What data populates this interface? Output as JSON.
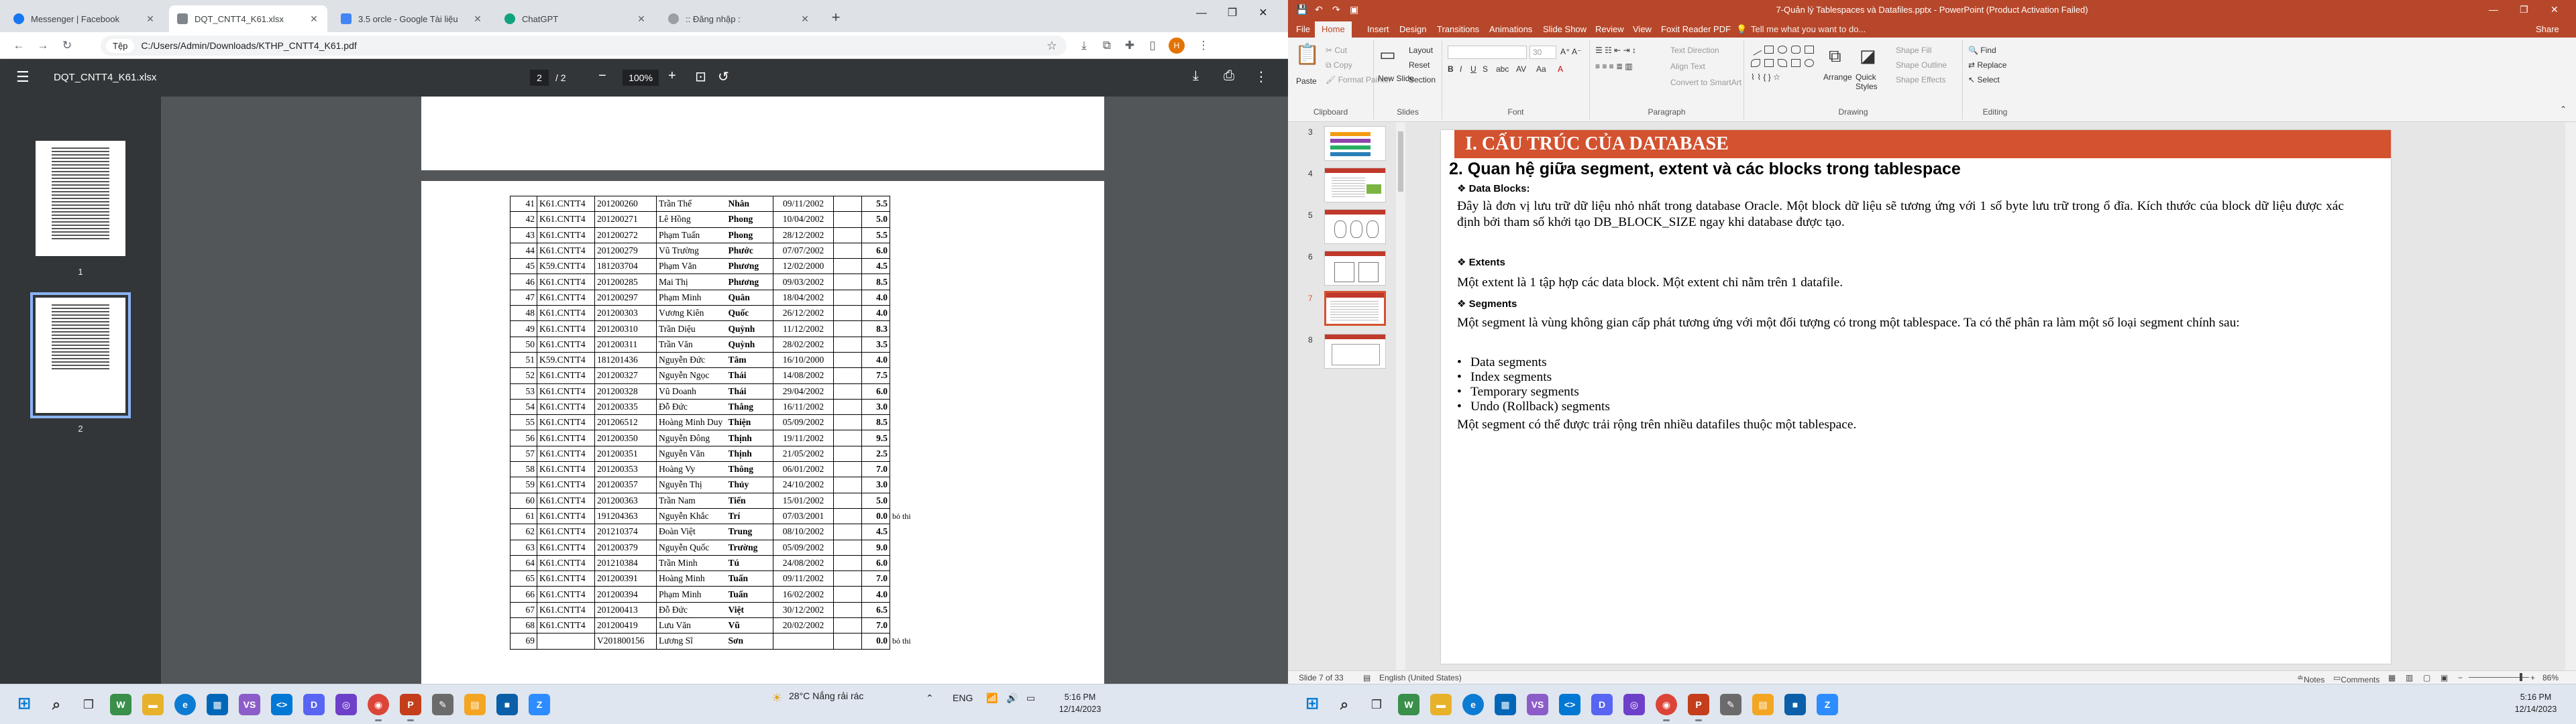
{
  "browser": {
    "tabs": [
      {
        "label": "Messenger | Facebook",
        "color": "#1877f2"
      },
      {
        "label": "DQT_CNTT4_K61.xlsx",
        "color": "#80868b"
      },
      {
        "label": "3.5 orcle - Google Tài liệu",
        "color": "#4285f4"
      },
      {
        "label": "ChatGPT",
        "color": "#10a37f"
      },
      {
        "label": ":: Đăng nhập :",
        "color": "#9aa0a6"
      }
    ],
    "omnibox_chip": "Tệp",
    "url": "C:/Users/Admin/Downloads/KTHP_CNTT4_K61.pdf",
    "profile_letter": "H"
  },
  "pdf": {
    "title": "DQT_CNTT4_K61.xlsx",
    "page_current": "2",
    "page_total": "/ 2",
    "zoom": "100%",
    "thumbnail_labels": [
      "1",
      "2"
    ],
    "rows": [
      [
        "41",
        "K61.CNTT4",
        "201200260",
        "Trần Thế",
        "Nhân",
        "09/11/2002",
        "",
        "5.5",
        ""
      ],
      [
        "42",
        "K61.CNTT4",
        "201200271",
        "Lê Hồng",
        "Phong",
        "10/04/2002",
        "",
        "5.0",
        ""
      ],
      [
        "43",
        "K61.CNTT4",
        "201200272",
        "Phạm Tuấn",
        "Phong",
        "28/12/2002",
        "",
        "5.5",
        ""
      ],
      [
        "44",
        "K61.CNTT4",
        "201200279",
        "Vũ Trường",
        "Phước",
        "07/07/2002",
        "",
        "6.0",
        ""
      ],
      [
        "45",
        "K59.CNTT4",
        "181203704",
        "Phạm Văn",
        "Phương",
        "12/02/2000",
        "",
        "4.5",
        ""
      ],
      [
        "46",
        "K61.CNTT4",
        "201200285",
        "Mai Thị",
        "Phương",
        "09/03/2002",
        "",
        "8.5",
        ""
      ],
      [
        "47",
        "K61.CNTT4",
        "201200297",
        "Phạm Minh",
        "Quân",
        "18/04/2002",
        "",
        "4.0",
        ""
      ],
      [
        "48",
        "K61.CNTT4",
        "201200303",
        "Vương Kiên",
        "Quốc",
        "26/12/2002",
        "",
        "4.0",
        ""
      ],
      [
        "49",
        "K61.CNTT4",
        "201200310",
        "Trần Diệu",
        "Quỳnh",
        "11/12/2002",
        "",
        "8.3",
        ""
      ],
      [
        "50",
        "K61.CNTT4",
        "201200311",
        "Trần Văn",
        "Quỳnh",
        "28/02/2002",
        "",
        "3.5",
        ""
      ],
      [
        "51",
        "K59.CNTT4",
        "181201436",
        "Nguyễn Đức",
        "Tâm",
        "16/10/2000",
        "",
        "4.0",
        ""
      ],
      [
        "52",
        "K61.CNTT4",
        "201200327",
        "Nguyễn Ngọc",
        "Thái",
        "14/08/2002",
        "",
        "7.5",
        ""
      ],
      [
        "53",
        "K61.CNTT4",
        "201200328",
        "Vũ Doanh",
        "Thái",
        "29/04/2002",
        "",
        "6.0",
        ""
      ],
      [
        "54",
        "K61.CNTT4",
        "201200335",
        "Đỗ Đức",
        "Thắng",
        "16/11/2002",
        "",
        "3.0",
        ""
      ],
      [
        "55",
        "K61.CNTT4",
        "201206512",
        "Hoàng Minh Duy",
        "Thiện",
        "05/09/2002",
        "",
        "8.5",
        ""
      ],
      [
        "56",
        "K61.CNTT4",
        "201200350",
        "Nguyễn Đông",
        "Thịnh",
        "19/11/2002",
        "",
        "9.5",
        ""
      ],
      [
        "57",
        "K61.CNTT4",
        "201200351",
        "Nguyễn Văn",
        "Thịnh",
        "21/05/2002",
        "",
        "2.5",
        ""
      ],
      [
        "58",
        "K61.CNTT4",
        "201200353",
        "Hoàng Vy",
        "Thông",
        "06/01/2002",
        "",
        "7.0",
        ""
      ],
      [
        "59",
        "K61.CNTT4",
        "201200357",
        "Nguyễn Thị",
        "Thủy",
        "24/10/2002",
        "",
        "3.0",
        ""
      ],
      [
        "60",
        "K61.CNTT4",
        "201200363",
        "Trần Nam",
        "Tiến",
        "15/01/2002",
        "",
        "5.0",
        ""
      ],
      [
        "61",
        "K61.CNTT4",
        "191204363",
        "Nguyễn Khắc",
        "Trí",
        "07/03/2001",
        "",
        "0.0",
        "bỏ thi"
      ],
      [
        "62",
        "K61.CNTT4",
        "201210374",
        "Đoàn Việt",
        "Trung",
        "08/10/2002",
        "",
        "4.5",
        ""
      ],
      [
        "63",
        "K61.CNTT4",
        "201200379",
        "Nguyễn Quốc",
        "Trường",
        "05/09/2002",
        "",
        "9.0",
        ""
      ],
      [
        "64",
        "K61.CNTT4",
        "201210384",
        "Trần Minh",
        "Tú",
        "24/08/2002",
        "",
        "6.0",
        ""
      ],
      [
        "65",
        "K61.CNTT4",
        "201200391",
        "Hoàng Minh",
        "Tuấn",
        "09/11/2002",
        "",
        "7.0",
        ""
      ],
      [
        "66",
        "K61.CNTT4",
        "201200394",
        "Phạm Minh",
        "Tuấn",
        "16/02/2002",
        "",
        "4.0",
        ""
      ],
      [
        "67",
        "K61.CNTT4",
        "201200413",
        "Đỗ Đức",
        "Việt",
        "30/12/2002",
        "",
        "6.5",
        ""
      ],
      [
        "68",
        "K61.CNTT4",
        "201200419",
        "Lưu Văn",
        "Vũ",
        "20/02/2002",
        "",
        "7.0",
        ""
      ],
      [
        "69",
        "",
        "V201800156",
        "Lương Sĩ",
        "Sơn",
        "",
        "",
        "0.0",
        "bỏ thi"
      ]
    ]
  },
  "taskbar_left": {
    "weather": "28°C  Nắng rải rác",
    "lang": "ENG",
    "time": "5:16 PM",
    "date": "12/14/2023"
  },
  "ppt": {
    "title": "7-Quản lý Tablespaces và Datafiles.pptx - PowerPoint (Product Activation Failed)",
    "tabs": [
      "File",
      "Home",
      "Insert",
      "Design",
      "Transitions",
      "Animations",
      "Slide Show",
      "Review",
      "View",
      "Foxit Reader PDF"
    ],
    "tell_me": "Tell me what you want to do...",
    "share": "Share",
    "ribbon": {
      "paste": "Paste",
      "cut": "Cut",
      "copy": "Copy",
      "format_painter": "Format Painter",
      "clipboard": "Clipboard",
      "new_slide": "New Slide",
      "layout": "Layout",
      "reset": "Reset",
      "section": "Section",
      "slides": "Slides",
      "font_size": "30",
      "font": "Font",
      "text_direction": "Text Direction",
      "align_text": "Align Text",
      "convert_smartart": "Convert to SmartArt",
      "paragraph": "Paragraph",
      "arrange": "Arrange",
      "quick_styles": "Quick Styles",
      "shape_fill": "Shape Fill",
      "shape_outline": "Shape Outline",
      "shape_effects": "Shape Effects",
      "drawing": "Drawing",
      "find": "Find",
      "replace": "Replace",
      "select": "Select",
      "editing": "Editing"
    },
    "slide_numbers": [
      "3",
      "4",
      "5",
      "6",
      "7",
      "8"
    ],
    "slide": {
      "banner": "I. CẤU TRÚC CỦA DATABASE",
      "subtitle": "2. Quan hệ giữa segment, extent và các blocks trong tablespace",
      "h_blocks": "Data Blocks:",
      "p_blocks": "Đây là đơn vị lưu trữ  dữ liệu nhỏ nhất trong database Oracle. Một block dữ liệu sẽ tương ứng với 1 số byte lưu trữ trong ổ đĩa. Kích thước của block dữ liệu được xác định bởi tham số khởi tạo DB_BLOCK_SIZE ngay khi database được tạo.",
      "h_extents": "Extents",
      "p_extents": "Một extent là 1 tập hợp các data block. Một extent chỉ nằm trên 1 datafile.",
      "h_segments": "Segments",
      "p_segments": "Một segment là vùng không gian cấp phát tương ứng với một đối tượng có trong một tablespace. Ta có thể phân ra làm một số loại segment chính sau:",
      "bullets": [
        "Data segments",
        "Index segments",
        "Temporary segments",
        "Undo (Rollback) segments"
      ],
      "p_last": "Một segment có thể được trải rộng trên nhiều datafiles thuộc một tablespace."
    },
    "status": {
      "slide_of": "Slide 7 of 33",
      "lang": "English (United States)",
      "notes": "Notes",
      "comments": "Comments",
      "zoom": "86%"
    }
  },
  "taskbar_right": {
    "time": "5:16 PM",
    "date": "12/14/2023"
  }
}
